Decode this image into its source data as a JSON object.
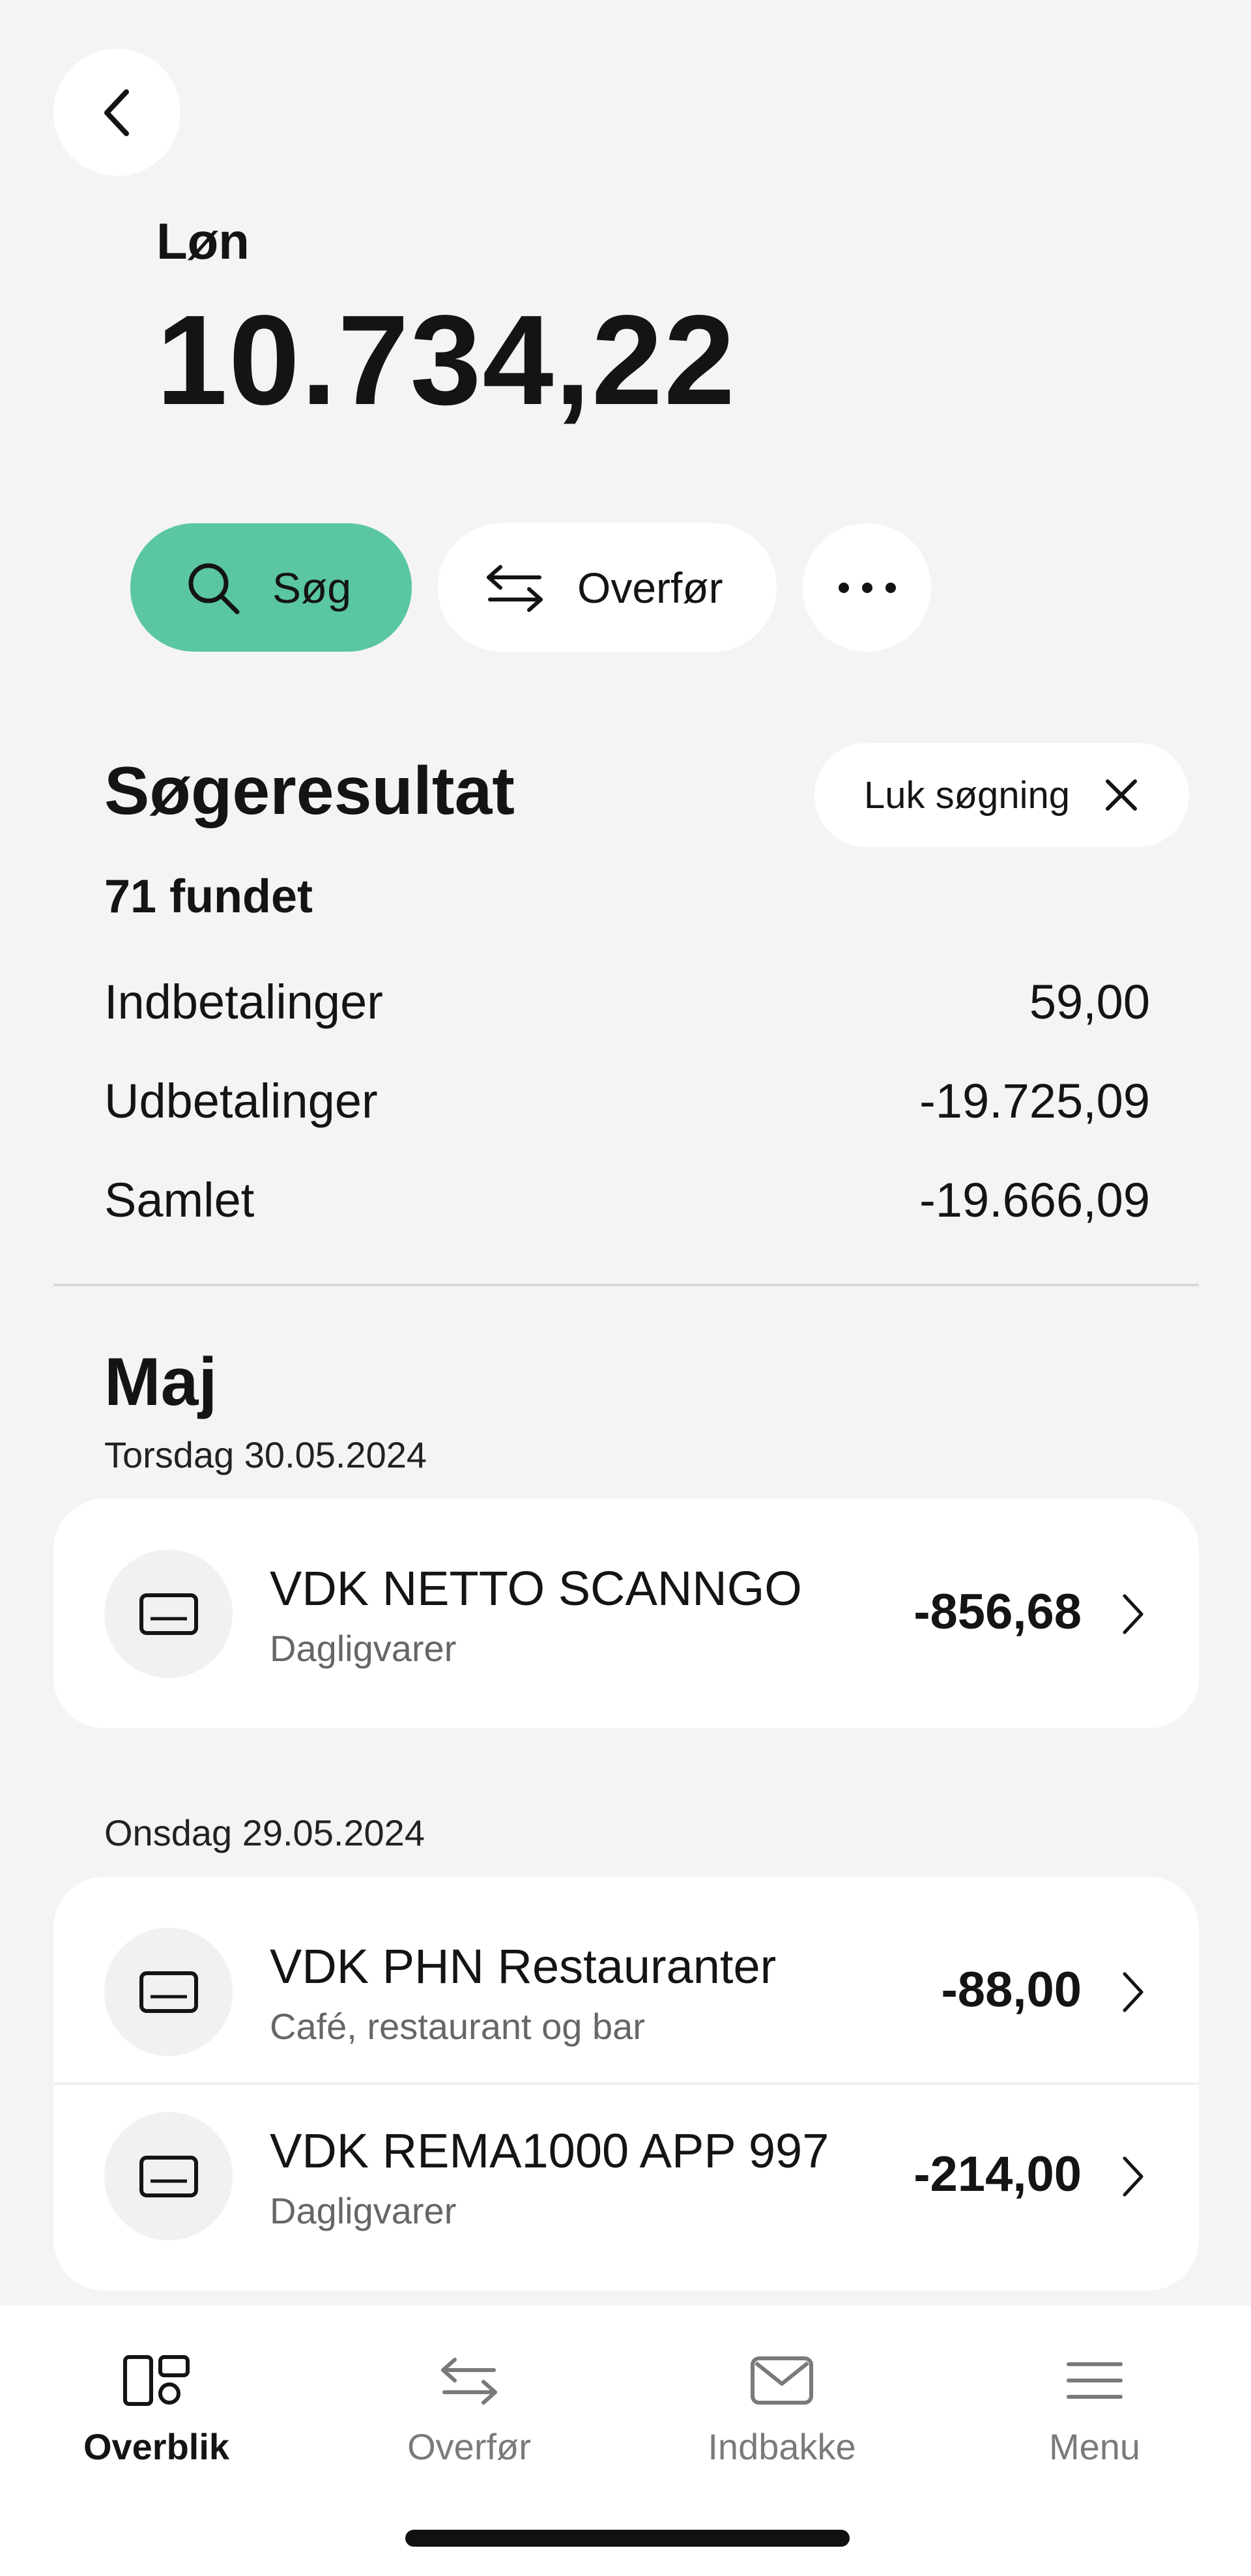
{
  "header": {
    "account_name": "Løn",
    "balance": "10.734,22"
  },
  "actions": {
    "search_label": "Søg",
    "transfer_label": "Overfør",
    "more_icon": "more-dots-icon"
  },
  "search_result": {
    "title": "Søgeresultat",
    "close_label": "Luk søgning",
    "found": "71 fundet",
    "rows": [
      {
        "label": "Indbetalinger",
        "value": "59,00"
      },
      {
        "label": "Udbetalinger",
        "value": "-19.725,09"
      },
      {
        "label": "Samlet",
        "value": "-19.666,09"
      }
    ]
  },
  "transactions": {
    "month": "Maj",
    "groups": [
      {
        "date": "Torsdag 30.05.2024",
        "items": [
          {
            "merchant": "VDK NETTO SCANNGO",
            "category": "Dagligvarer",
            "amount": "-856,68"
          }
        ]
      },
      {
        "date": "Onsdag 29.05.2024",
        "items": [
          {
            "merchant": "VDK PHN Restauranter",
            "category": "Café, restaurant og bar",
            "amount": "-88,00"
          },
          {
            "merchant": "VDK REMA1000 APP 997",
            "category": "Dagligvarer",
            "amount": "-214,00"
          }
        ]
      }
    ]
  },
  "bottom_nav": {
    "items": [
      {
        "label": "Overblik",
        "icon": "overview-icon",
        "active": true
      },
      {
        "label": "Overfør",
        "icon": "transfer-arrows-icon",
        "active": false
      },
      {
        "label": "Indbakke",
        "icon": "envelope-icon",
        "active": false
      },
      {
        "label": "Menu",
        "icon": "hamburger-menu-icon",
        "active": false
      }
    ]
  },
  "colors": {
    "accent": "#5ac6a3",
    "background": "#f4f4f4",
    "card": "#ffffff",
    "text": "#141414",
    "muted": "#666666"
  }
}
